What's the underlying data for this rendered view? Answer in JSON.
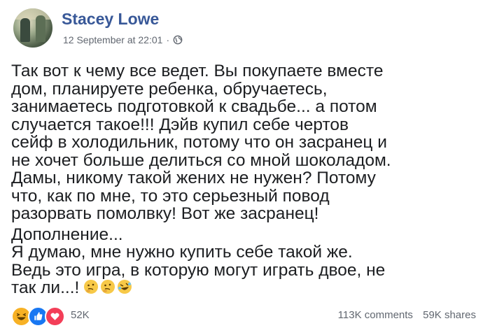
{
  "post": {
    "author": "Stacey Lowe",
    "timestamp": "12 September at 22:01",
    "separator": "·",
    "audience_icon": "globe-icon",
    "body_lines": [
      "Так вот к чему все ведет. Вы покупаете вместе",
      "дом, планируете ребенка, обручаетесь,",
      "занимаетесь подготовкой к свадьбе... а потом",
      "случается такое!!! Дэйв купил себе чертов",
      "сейф в холодильник, потому что он засранец и",
      "не хочет больше делиться со мной шоколадом.",
      "Дамы, никому такой жених не нужен? Потому",
      "что, как по мне, то это серьезный повод",
      "разорвать помолвку! Вот же засранец!"
    ],
    "addendum_lines": [
      "Дополнение...",
      "Я думаю, мне нужно купить себе такой же.",
      "Ведь это игра, в которую могут играть двое, не",
      "так ли...!"
    ],
    "addendum_emojis": [
      "thinking-face-icon",
      "thinking-face-icon",
      "rofl-face-icon"
    ]
  },
  "footer": {
    "reaction_icons": [
      "haha-reaction-icon",
      "like-reaction-icon",
      "love-reaction-icon"
    ],
    "reaction_count": "52K",
    "comments": "113K comments",
    "shares": "59K shares"
  },
  "colors": {
    "author_link": "#385898",
    "meta_text": "#616770",
    "like_blue": "#1877f2",
    "love_red": "#f33e58",
    "haha_yellow": "#f7b125"
  }
}
